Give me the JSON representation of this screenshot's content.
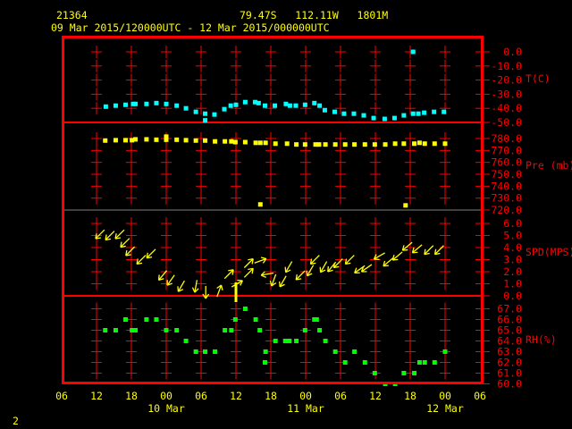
{
  "header": {
    "station": "21364",
    "location": "79.47S   112.11W   1801M",
    "period": "09 Mar 2015/120000UTC - 12 Mar 2015/000000UTC"
  },
  "page_number": "2",
  "colors": {
    "frame": "#ff0000",
    "text": "#ffff00",
    "temperature": "#00ffff",
    "pressure": "#ffff00",
    "wind": "#ffff00",
    "rh": "#00ff00",
    "axis_labels": "#ff0000"
  },
  "chart_data": {
    "type": "scatter",
    "grid": true,
    "x_axis": {
      "range": [
        "2015-03-09T06:00",
        "2015-03-12T06:00"
      ],
      "tick_labels": [
        "06",
        "12",
        "18",
        "00",
        "06",
        "12",
        "18",
        "00",
        "06",
        "12",
        "18",
        "00",
        "06"
      ],
      "date_labels": [
        {
          "t": "2015-03-10T00:00",
          "label": "10 Mar"
        },
        {
          "t": "2015-03-11T00:00",
          "label": "11 Mar"
        },
        {
          "t": "2015-03-12T00:00",
          "label": "12 Mar"
        }
      ]
    },
    "panels": [
      {
        "key": "temp",
        "ylabel": "T(C)",
        "ylim": [
          -50,
          0
        ],
        "tick_labels": [
          "0.0",
          "-10.0",
          "-20.0",
          "-30.0",
          "-40.0",
          "-50.0"
        ],
        "points": [
          [
            "2015-03-09T13:36",
            -38.8
          ],
          [
            "2015-03-09T15:18",
            -38.1
          ],
          [
            "2015-03-09T17:00",
            -37.5
          ],
          [
            "2015-03-09T18:18",
            -36.9
          ],
          [
            "2015-03-09T18:42",
            -36.9
          ],
          [
            "2015-03-09T20:36",
            -36.9
          ],
          [
            "2015-03-09T22:18",
            -36.3
          ],
          [
            "2015-03-10T00:00",
            -36.9
          ],
          [
            "2015-03-10T01:48",
            -38.1
          ],
          [
            "2015-03-10T03:24",
            -40.0
          ],
          [
            "2015-03-10T05:06",
            -42.5
          ],
          [
            "2015-03-10T06:42",
            -43.8
          ],
          [
            "2015-03-10T06:42",
            -48.5
          ],
          [
            "2015-03-10T08:18",
            -44.4
          ],
          [
            "2015-03-10T10:00",
            -40.6
          ],
          [
            "2015-03-10T11:06",
            -38.1
          ],
          [
            "2015-03-10T12:00",
            -37.5
          ],
          [
            "2015-03-10T13:36",
            -35.6
          ],
          [
            "2015-03-10T15:18",
            -35.6
          ],
          [
            "2015-03-10T15:54",
            -36.3
          ],
          [
            "2015-03-10T17:00",
            -38.1
          ],
          [
            "2015-03-10T18:42",
            -38.1
          ],
          [
            "2015-03-10T20:36",
            -36.9
          ],
          [
            "2015-03-10T21:18",
            -38.1
          ],
          [
            "2015-03-10T22:18",
            -38.1
          ],
          [
            "2015-03-10T23:54",
            -37.5
          ],
          [
            "2015-03-11T01:30",
            -36.3
          ],
          [
            "2015-03-11T02:24",
            -38.1
          ],
          [
            "2015-03-11T03:18",
            -41.3
          ],
          [
            "2015-03-11T05:00",
            -42.5
          ],
          [
            "2015-03-11T06:36",
            -43.8
          ],
          [
            "2015-03-11T08:18",
            -43.8
          ],
          [
            "2015-03-11T10:00",
            -45.0
          ],
          [
            "2015-03-11T11:42",
            -46.9
          ],
          [
            "2015-03-11T13:36",
            -47.5
          ],
          [
            "2015-03-11T15:18",
            -46.9
          ],
          [
            "2015-03-11T16:54",
            -45.0
          ],
          [
            "2015-03-11T18:30",
            -43.8
          ],
          [
            "2015-03-11T18:30",
            0.0
          ],
          [
            "2015-03-11T19:24",
            -43.8
          ],
          [
            "2015-03-11T20:24",
            -43.1
          ],
          [
            "2015-03-11T22:06",
            -42.5
          ],
          [
            "2015-03-11T23:48",
            -42.5
          ]
        ]
      },
      {
        "key": "pres",
        "ylabel": "Pre (mb)",
        "ylim": [
          720,
          780
        ],
        "tick_labels": [
          "780.0",
          "770.0",
          "760.0",
          "750.0",
          "740.0",
          "730.0",
          "720.0"
        ],
        "points": [
          [
            "2015-03-09T13:30",
            778.3
          ],
          [
            "2015-03-09T15:18",
            778.6
          ],
          [
            "2015-03-09T17:00",
            778.6
          ],
          [
            "2015-03-09T18:06",
            778.6
          ],
          [
            "2015-03-09T18:42",
            779.3
          ],
          [
            "2015-03-09T20:36",
            779.3
          ],
          [
            "2015-03-09T22:18",
            779.0
          ],
          [
            "2015-03-10T00:00",
            779.0
          ],
          [
            "2015-03-10T00:00",
            781.6
          ],
          [
            "2015-03-10T01:48",
            779.0
          ],
          [
            "2015-03-10T03:24",
            778.6
          ],
          [
            "2015-03-10T05:06",
            778.3
          ],
          [
            "2015-03-10T06:42",
            778.3
          ],
          [
            "2015-03-10T08:24",
            777.6
          ],
          [
            "2015-03-10T10:06",
            777.6
          ],
          [
            "2015-03-10T11:12",
            777.6
          ],
          [
            "2015-03-10T11:54",
            777.0
          ],
          [
            "2015-03-10T13:36",
            777.0
          ],
          [
            "2015-03-10T15:24",
            776.4
          ],
          [
            "2015-03-10T16:12",
            776.4
          ],
          [
            "2015-03-10T16:12",
            724.7
          ],
          [
            "2015-03-10T17:06",
            776.4
          ],
          [
            "2015-03-10T18:48",
            775.7
          ],
          [
            "2015-03-10T20:48",
            775.7
          ],
          [
            "2015-03-10T22:24",
            775.0
          ],
          [
            "2015-03-10T23:54",
            775.0
          ],
          [
            "2015-03-11T01:42",
            775.0
          ],
          [
            "2015-03-11T02:18",
            775.0
          ],
          [
            "2015-03-11T03:24",
            775.0
          ],
          [
            "2015-03-11T05:06",
            775.0
          ],
          [
            "2015-03-11T06:48",
            775.0
          ],
          [
            "2015-03-11T08:24",
            775.0
          ],
          [
            "2015-03-11T10:12",
            775.0
          ],
          [
            "2015-03-11T11:54",
            775.0
          ],
          [
            "2015-03-11T13:42",
            775.0
          ],
          [
            "2015-03-11T15:24",
            775.7
          ],
          [
            "2015-03-11T16:54",
            775.7
          ],
          [
            "2015-03-11T17:12",
            723.9
          ],
          [
            "2015-03-11T18:42",
            775.7
          ],
          [
            "2015-03-11T19:36",
            776.4
          ],
          [
            "2015-03-11T20:30",
            775.7
          ],
          [
            "2015-03-11T22:12",
            775.7
          ],
          [
            "2015-03-12T00:00",
            775.7
          ]
        ]
      },
      {
        "key": "wind",
        "ylabel": "SPD(MPS)",
        "ylim": [
          0,
          6
        ],
        "tick_labels": [
          "6.0",
          "5.0",
          "4.0",
          "3.0",
          "2.0",
          "1.0",
          "0.0"
        ],
        "points": [
          [
            "2015-03-09T12:36",
            5.1,
            45
          ],
          [
            "2015-03-09T14:18",
            5.0,
            45
          ],
          [
            "2015-03-09T16:00",
            5.1,
            45
          ],
          [
            "2015-03-09T16:54",
            4.4,
            45
          ],
          [
            "2015-03-09T17:48",
            3.7,
            45
          ],
          [
            "2015-03-09T19:42",
            3.0,
            45
          ],
          [
            "2015-03-09T21:24",
            3.5,
            45
          ],
          [
            "2015-03-09T23:24",
            1.7,
            40
          ],
          [
            "2015-03-10T00:48",
            1.3,
            35
          ],
          [
            "2015-03-10T02:36",
            0.8,
            30
          ],
          [
            "2015-03-10T05:06",
            0.8,
            10
          ],
          [
            "2015-03-10T06:48",
            0.3,
            0
          ],
          [
            "2015-03-10T09:06",
            0.4,
            200
          ],
          [
            "2015-03-10T10:48",
            1.8,
            225
          ],
          [
            "2015-03-10T12:00",
            0.0,
            null
          ],
          [
            "2015-03-10T12:12",
            1.0,
            240
          ],
          [
            "2015-03-10T14:12",
            2.7,
            225
          ],
          [
            "2015-03-10T14:12",
            1.9,
            225
          ],
          [
            "2015-03-10T16:12",
            2.9,
            250
          ],
          [
            "2015-03-10T17:24",
            1.8,
            80
          ],
          [
            "2015-03-10T18:30",
            1.3,
            20
          ],
          [
            "2015-03-10T20:06",
            1.2,
            30
          ],
          [
            "2015-03-10T21:06",
            2.4,
            30
          ],
          [
            "2015-03-10T23:06",
            1.7,
            45
          ],
          [
            "2015-03-11T00:48",
            2.1,
            30
          ],
          [
            "2015-03-11T01:36",
            3.0,
            45
          ],
          [
            "2015-03-11T03:06",
            2.4,
            30
          ],
          [
            "2015-03-11T04:30",
            2.4,
            40
          ],
          [
            "2015-03-11T05:36",
            2.7,
            45
          ],
          [
            "2015-03-11T07:36",
            3.0,
            45
          ],
          [
            "2015-03-11T09:18",
            2.2,
            55
          ],
          [
            "2015-03-11T10:30",
            2.3,
            55
          ],
          [
            "2015-03-11T12:42",
            3.3,
            60
          ],
          [
            "2015-03-11T14:12",
            2.8,
            50
          ],
          [
            "2015-03-11T15:48",
            3.3,
            50
          ],
          [
            "2015-03-11T17:30",
            4.1,
            50
          ],
          [
            "2015-03-11T19:12",
            3.9,
            50
          ],
          [
            "2015-03-11T21:12",
            3.8,
            45
          ],
          [
            "2015-03-11T23:00",
            3.8,
            45
          ]
        ]
      },
      {
        "key": "rh",
        "ylabel": "RH(%)",
        "ylim": [
          60,
          67
        ],
        "tick_labels": [
          "67.0",
          "66.0",
          "65.0",
          "64.0",
          "63.0",
          "62.0",
          "61.0",
          "60.0"
        ],
        "points": [
          [
            "2015-03-09T13:30",
            65
          ],
          [
            "2015-03-09T15:18",
            65
          ],
          [
            "2015-03-09T17:00",
            66
          ],
          [
            "2015-03-09T18:06",
            65
          ],
          [
            "2015-03-09T18:42",
            65
          ],
          [
            "2015-03-09T20:36",
            66
          ],
          [
            "2015-03-09T22:18",
            66
          ],
          [
            "2015-03-10T00:00",
            65
          ],
          [
            "2015-03-10T01:48",
            65
          ],
          [
            "2015-03-10T03:24",
            64
          ],
          [
            "2015-03-10T05:06",
            63
          ],
          [
            "2015-03-10T06:42",
            63
          ],
          [
            "2015-03-10T08:24",
            63
          ],
          [
            "2015-03-10T10:06",
            65
          ],
          [
            "2015-03-10T11:12",
            65
          ],
          [
            "2015-03-10T11:54",
            66
          ],
          [
            "2015-03-10T13:36",
            67
          ],
          [
            "2015-03-10T15:24",
            66
          ],
          [
            "2015-03-10T16:06",
            65
          ],
          [
            "2015-03-10T17:00",
            62
          ],
          [
            "2015-03-10T17:06",
            63
          ],
          [
            "2015-03-10T18:48",
            64
          ],
          [
            "2015-03-10T20:30",
            64
          ],
          [
            "2015-03-10T21:12",
            64
          ],
          [
            "2015-03-10T22:24",
            64
          ],
          [
            "2015-03-10T23:54",
            65
          ],
          [
            "2015-03-11T01:30",
            66
          ],
          [
            "2015-03-11T01:54",
            66
          ],
          [
            "2015-03-11T02:24",
            65
          ],
          [
            "2015-03-11T03:24",
            64
          ],
          [
            "2015-03-11T05:06",
            63
          ],
          [
            "2015-03-11T06:48",
            62
          ],
          [
            "2015-03-11T08:24",
            63
          ],
          [
            "2015-03-11T10:12",
            62
          ],
          [
            "2015-03-11T11:54",
            61
          ],
          [
            "2015-03-11T13:42",
            60
          ],
          [
            "2015-03-11T15:24",
            60
          ],
          [
            "2015-03-11T16:54",
            61
          ],
          [
            "2015-03-11T18:42",
            61
          ],
          [
            "2015-03-11T19:36",
            62
          ],
          [
            "2015-03-11T20:30",
            62
          ],
          [
            "2015-03-11T22:12",
            62
          ],
          [
            "2015-03-12T00:00",
            63
          ]
        ]
      }
    ]
  }
}
